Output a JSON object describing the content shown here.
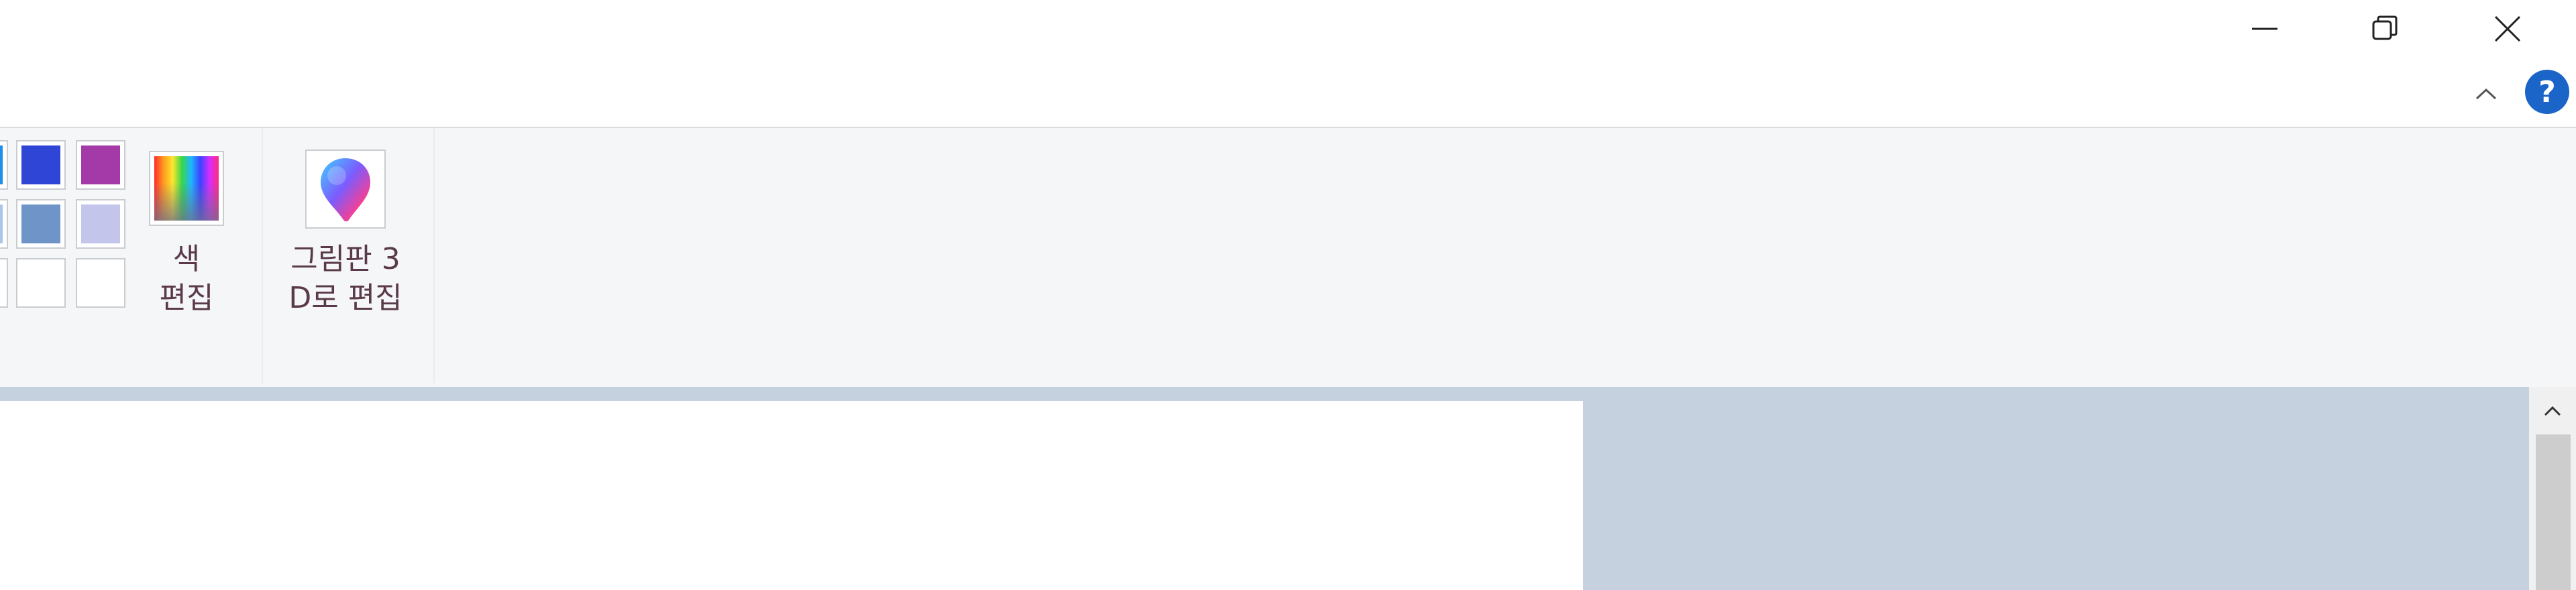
{
  "window_controls": {
    "minimize_icon": "minimize-icon",
    "restore_icon": "restore-icon",
    "close_icon": "close-icon"
  },
  "ribbon_controls": {
    "collapse_icon": "chevron-up-icon",
    "help_label": "?"
  },
  "palette": {
    "row1": [
      "#1f8ee8",
      "#2f45d6",
      "#a33aa8"
    ],
    "row2": [
      "#a9c8e8",
      "#6f95c8",
      "#c3c5ea"
    ],
    "row3": [
      "#ffffff",
      "#ffffff",
      "#ffffff"
    ]
  },
  "edit_colors": {
    "label_line1": "색",
    "label_line2": "편집"
  },
  "paint3d": {
    "label_line1": "그림판 3",
    "label_line2": "D로 편집"
  },
  "colors": {
    "canvas_background": "#c6d1e0",
    "canvas": "#ffffff",
    "help_accent": "#1b64c8"
  }
}
